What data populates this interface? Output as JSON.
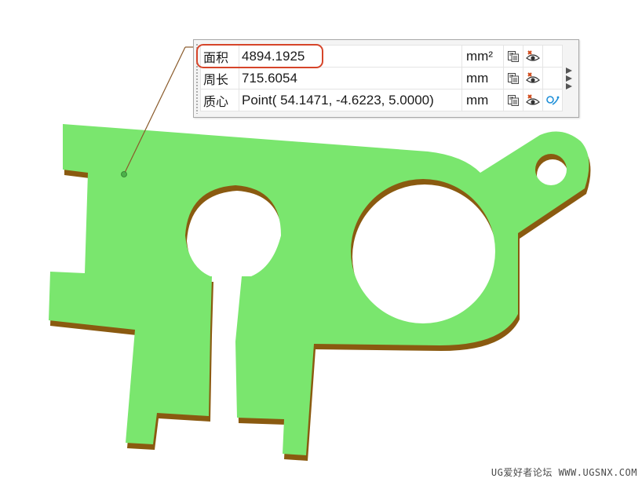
{
  "measure_panel": {
    "rows": [
      {
        "label": "面积",
        "value": "4894.1925",
        "unit": "mm²"
      },
      {
        "label": "周长",
        "value": "715.6054",
        "unit": "mm"
      },
      {
        "label": "质心",
        "value": "Point( 54.1471, -4.6223, 5.0000)",
        "unit": "mm"
      }
    ]
  },
  "watermark": "UG爱好者论坛 WWW.UGSNX.COM",
  "colors": {
    "part_face": "#7ae66e",
    "part_edge": "#8a5a10",
    "highlight": "#d6452a",
    "leader": "#8a5a2a"
  }
}
